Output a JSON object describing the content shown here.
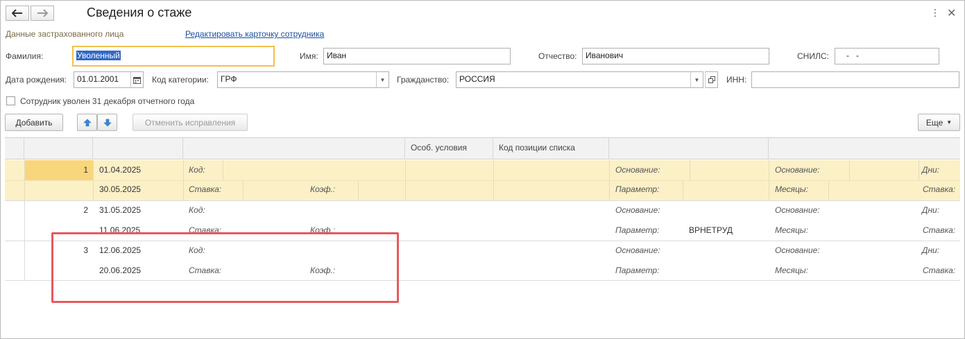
{
  "window": {
    "title": "Сведения о стаже",
    "section_title": "Данные застрахованного лица",
    "edit_link": "Редактировать карточку сотрудника"
  },
  "form": {
    "surname_label": "Фамилия:",
    "surname_value": "Уволенный",
    "name_label": "Имя:",
    "name_value": "Иван",
    "patronymic_label": "Отчество:",
    "patronymic_value": "Иванович",
    "snils_label": "СНИЛС:",
    "snils_value": "-   -",
    "birthdate_label": "Дата рождения:",
    "birthdate_value": "01.01.2001",
    "category_label": "Код категории:",
    "category_value": "ГРФ",
    "citizenship_label": "Гражданство:",
    "citizenship_value": "РОССИЯ",
    "inn_label": "ИНН:",
    "inn_value": "",
    "dismissed_checkbox_label": "Сотрудник уволен 31 декабря отчетного года",
    "dismissed_checked": false
  },
  "toolbar": {
    "add_label": "Добавить",
    "cancel_corrections_label": "Отменить исправления",
    "more_label": "Еще"
  },
  "table": {
    "columns": [
      "",
      "",
      "",
      "Особ. условия",
      "Код позиции списка",
      "",
      ""
    ],
    "labels": {
      "kod": "Код:",
      "stavka": "Ставка:",
      "koef": "Коэф.:",
      "osnovanie": "Основание:",
      "parametr": "Параметр:",
      "mesyacy": "Месяцы:",
      "dni": "Дни:"
    },
    "rows": [
      {
        "num": "1",
        "date_start": "01.04.2025",
        "date_end": "30.05.2025",
        "parametr_value": "",
        "selected": true
      },
      {
        "num": "2",
        "date_start": "31.05.2025",
        "date_end": "11.06.2025",
        "parametr_value": "ВРНЕТРУД",
        "selected": false
      },
      {
        "num": "3",
        "date_start": "12.06.2025",
        "date_end": "20.06.2025",
        "parametr_value": "",
        "selected": false
      }
    ]
  },
  "colors": {
    "selected_row": "#fcf0c7",
    "current_cell": "#f8d67c",
    "focus_border": "#f2c14e",
    "highlight_box": "#e8585c",
    "link": "#1a4f9c"
  }
}
